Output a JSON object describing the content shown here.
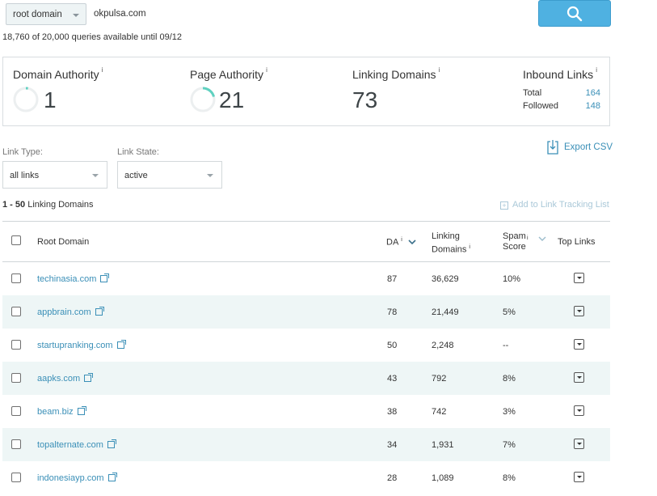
{
  "search": {
    "scope_value": "root domain",
    "query_value": "okpulsa.com",
    "quota_text": "18,760 of 20,000 queries available until 09/12"
  },
  "metrics": {
    "domain_authority": {
      "title": "Domain Authority",
      "info": "i",
      "value": "1",
      "ring_fraction": 0.01
    },
    "page_authority": {
      "title": "Page Authority",
      "info": "i",
      "value": "21",
      "ring_fraction": 0.21
    },
    "linking_domains": {
      "title": "Linking Domains",
      "info": "i",
      "value": "73"
    },
    "inbound_links": {
      "title": "Inbound Links",
      "info": "i",
      "total_label": "Total",
      "total_value": "164",
      "followed_label": "Followed",
      "followed_value": "148"
    }
  },
  "filters": {
    "link_type_label": "Link Type:",
    "link_type_value": "all links",
    "link_state_label": "Link State:",
    "link_state_value": "active"
  },
  "actions": {
    "export_label": "Export CSV",
    "add_tracking_label": "Add to Link Tracking List"
  },
  "results": {
    "range": "1 - 50",
    "label": "Linking Domains"
  },
  "table": {
    "columns": {
      "root_domain": "Root Domain",
      "da": "DA",
      "linking_domains_line1": "Linking",
      "linking_domains_line2": "Domains",
      "spam_line1": "Spam",
      "spam_line2": "Score",
      "top_links": "Top Links",
      "info": "i"
    },
    "rows": [
      {
        "domain": "techinasia.com",
        "da": "87",
        "linking": "36,629",
        "spam": "10%"
      },
      {
        "domain": "appbrain.com",
        "da": "78",
        "linking": "21,449",
        "spam": "5%"
      },
      {
        "domain": "startupranking.com",
        "da": "50",
        "linking": "2,248",
        "spam": "--"
      },
      {
        "domain": "aapks.com",
        "da": "43",
        "linking": "792",
        "spam": "8%"
      },
      {
        "domain": "beam.biz",
        "da": "38",
        "linking": "742",
        "spam": "3%"
      },
      {
        "domain": "topalternate.com",
        "da": "34",
        "linking": "1,931",
        "spam": "7%"
      },
      {
        "domain": "indonesiayp.com",
        "da": "28",
        "linking": "1,089",
        "spam": "8%"
      }
    ]
  },
  "colors": {
    "accent_blue": "#4fb1e1",
    "link_blue": "#3a8fb7",
    "ring_teal": "#5fd1c0",
    "row_alt": "#eef6f6"
  }
}
